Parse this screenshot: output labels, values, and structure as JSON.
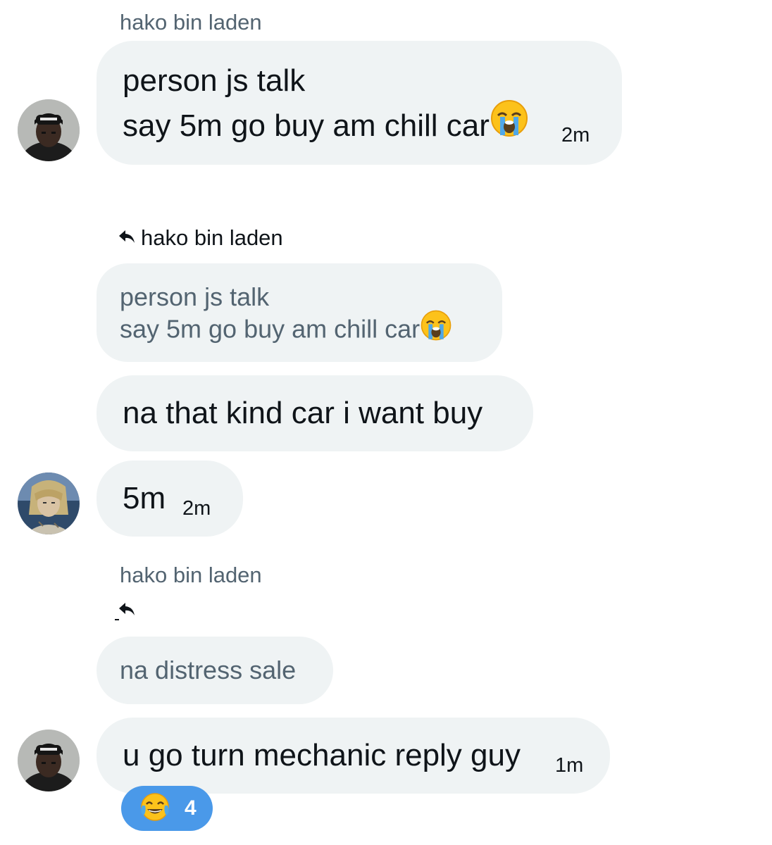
{
  "conversation": {
    "messages": [
      {
        "sender": "hako bin laden",
        "line1": "person js talk",
        "line2": "say 5m go buy am chill car",
        "emoji": "loudly-crying-face-icon",
        "time": "2m"
      },
      {
        "reply_to": "hako bin laden",
        "quoted_line1": "person js talk",
        "quoted_line2": "say 5m go buy am chill car",
        "quoted_emoji": "loudly-crying-face-icon",
        "text": "na that kind car i want buy"
      },
      {
        "text": "5m",
        "time": "2m"
      },
      {
        "sender": "hako bin laden",
        "reply_icon": "reply-arrow-icon",
        "quoted_text": "na distress sale"
      },
      {
        "text": "u go turn mechanic reply guy",
        "time": "1m",
        "reaction": {
          "emoji": "face-with-tears-of-joy-icon",
          "count": "4"
        }
      }
    ]
  },
  "colors": {
    "bubble": "#eff3f4",
    "secondary_text": "#536471",
    "primary_text": "#0f1419",
    "reaction_badge": "#4a99e9"
  }
}
